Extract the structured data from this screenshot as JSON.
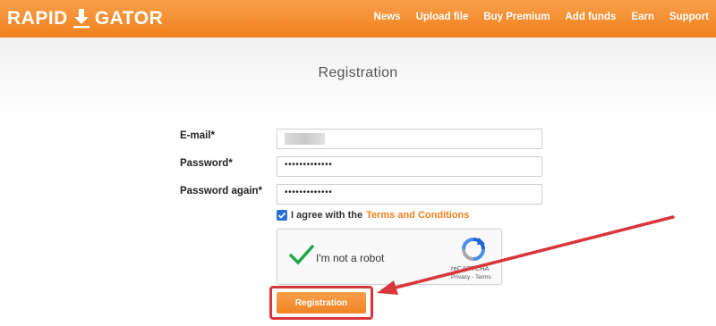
{
  "header": {
    "logo_left": "RAPID",
    "logo_right": "GATOR",
    "logo_icon": "download-arrow-icon",
    "nav": [
      "News",
      "Upload file",
      "Buy Premium",
      "Add funds",
      "Earn",
      "Support"
    ]
  },
  "page": {
    "title": "Registration"
  },
  "form": {
    "email_label": "E-mail*",
    "password_label": "Password*",
    "password_again_label": "Password again*",
    "password_value": "•••••••••••••",
    "password_again_value": "•••••••••••••",
    "agree_text": "I agree with the",
    "terms_link": "Terms and Conditions",
    "agree_checked": true,
    "submit_label": "Registration"
  },
  "captcha": {
    "label": "I'm not a robot",
    "brand": "reCAPTCHA",
    "privacy": "Privacy",
    "separator": " - ",
    "terms": "Terms"
  },
  "colors": {
    "brand_orange": "#f07f1c",
    "annotation_red": "#d9363c",
    "checkbox_blue": "#2b6fd6",
    "captcha_check_green": "#1fa64a"
  }
}
